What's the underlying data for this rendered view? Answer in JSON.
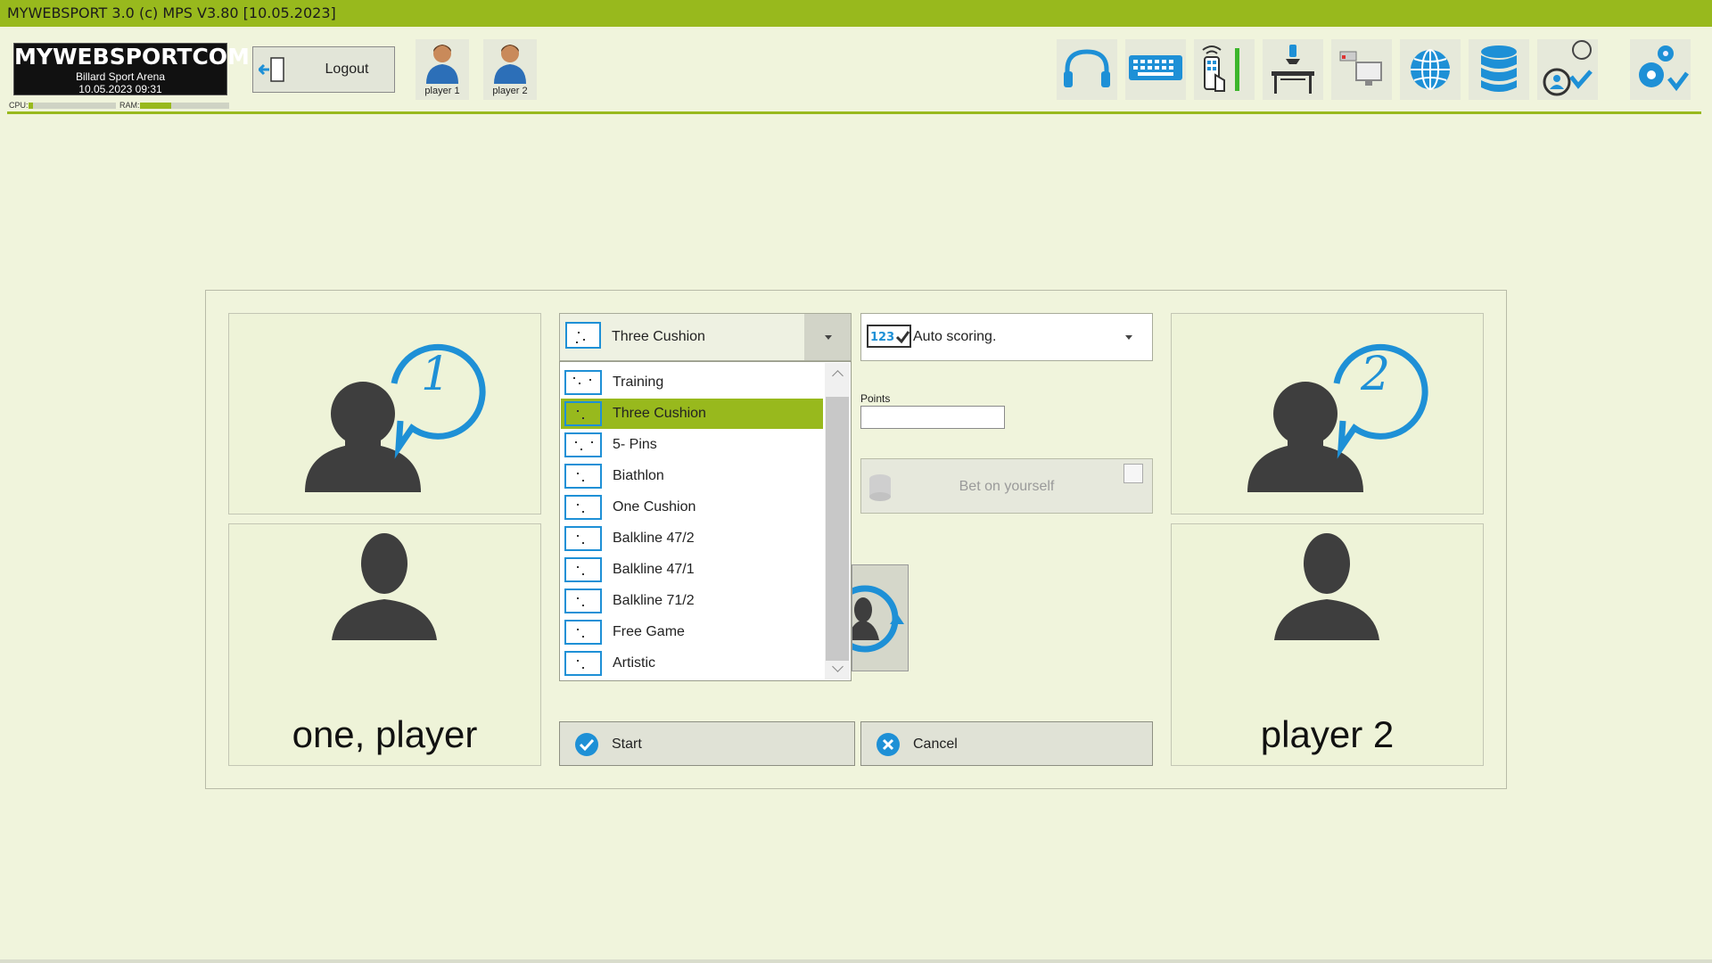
{
  "window": {
    "title": "MYWEBSPORT 3.0  (c) MPS V3.80 [10.05.2023]"
  },
  "logo": {
    "brand": "MYWEBSPORTCOM",
    "subtitle": "Billard Sport Arena",
    "datetime": "10.05.2023  09:31"
  },
  "system": {
    "cpu_label": "CPU:",
    "ram_label": "RAM:",
    "cpu_level": 0.05,
    "ram_level": 0.35
  },
  "header": {
    "logout_label": "Logout",
    "players": [
      {
        "label": "player 1"
      },
      {
        "label": "player 2"
      }
    ],
    "tools": [
      "headphones-icon",
      "keyboard-icon",
      "remote-control-icon",
      "table-light-icon",
      "camera-monitor-icon",
      "globe-icon",
      "database-icon",
      "user-select-icon",
      "settings-icon"
    ]
  },
  "game": {
    "discipline_selected": "Three Cushion",
    "disciplines": [
      "Training",
      "Three Cushion",
      "5- Pins",
      "Biathlon",
      "One Cushion",
      "Balkline 47/2",
      "Balkline 47/1",
      "Balkline 71/2",
      "Free Game",
      "Artistic"
    ],
    "scoring_mode": "Auto scoring.",
    "points_label": "Points",
    "points_value": "",
    "bet_label": "Bet on yourself",
    "bet_checked": false
  },
  "player1": {
    "name": "one, player",
    "badge": "1"
  },
  "player2": {
    "name": "player 2",
    "badge": "2"
  },
  "actions": {
    "start_label": "Start",
    "cancel_label": "Cancel"
  },
  "colors": {
    "accent": "#98b91d",
    "background": "#f0f4dc",
    "icon_blue": "#1e90d6",
    "silhouette": "#3e3e3e"
  }
}
